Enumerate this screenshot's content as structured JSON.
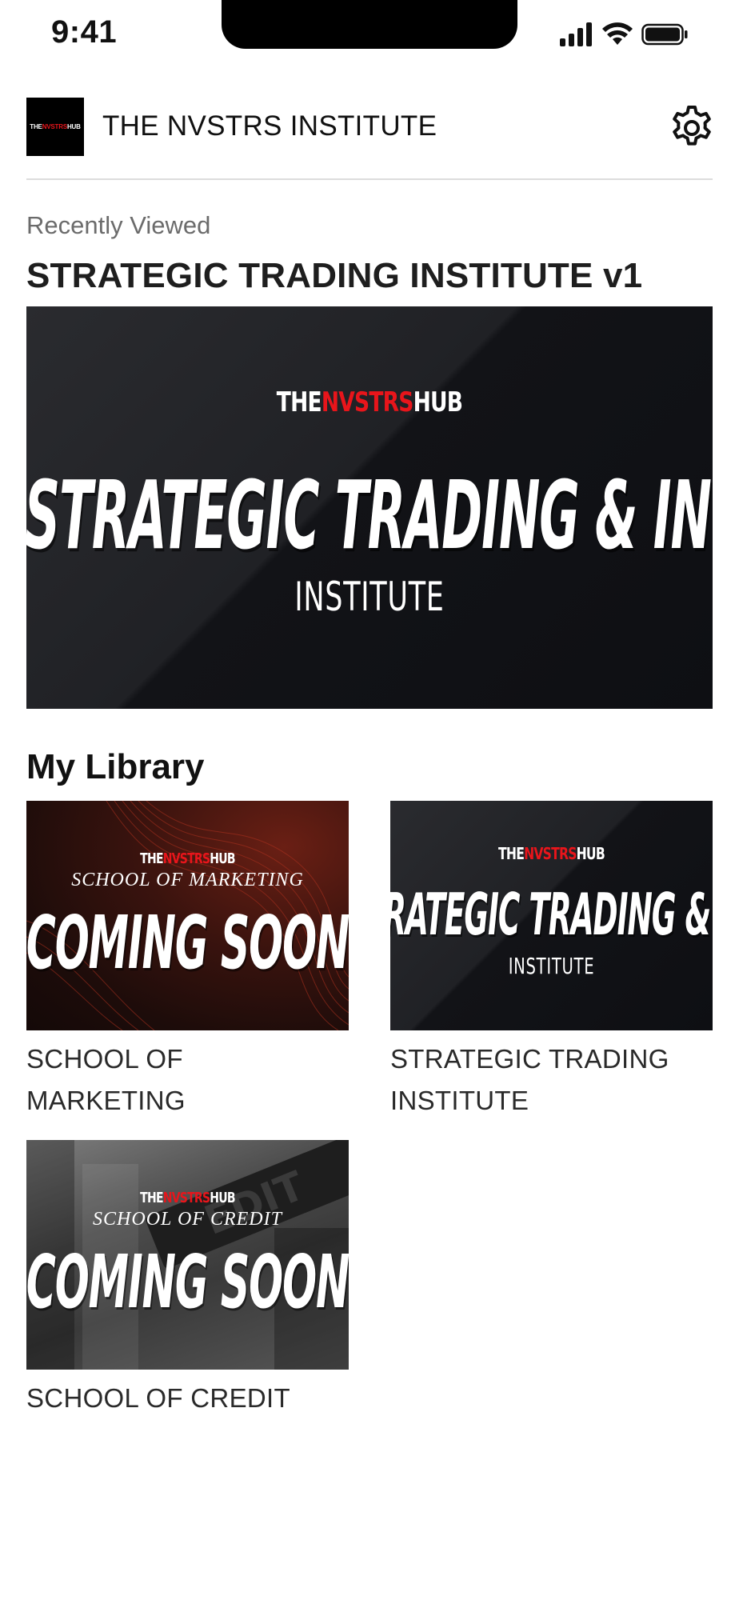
{
  "status_bar": {
    "time": "9:41"
  },
  "header": {
    "logo_parts": [
      "THE",
      "NVSTRS",
      "HUB"
    ],
    "title": "THE NVSTRS INSTITUTE"
  },
  "recently_viewed": {
    "label": "Recently Viewed",
    "title": "STRATEGIC TRADING INSTITUTE v1",
    "banner": {
      "logo_parts": [
        "THE",
        "NVSTRS",
        "HUB"
      ],
      "headline": "STRATEGIC TRADING & INVESTING",
      "subline": "INSTITUTE"
    }
  },
  "library": {
    "title": "My Library",
    "items": [
      {
        "label_line1": "SCHOOL OF",
        "label_line2": "MARKETING",
        "logo_parts": [
          "THE",
          "NVSTRS",
          "HUB"
        ],
        "school": "SCHOOL OF MARKETING",
        "status": "COMING SOON"
      },
      {
        "label_line1": "STRATEGIC TRADING",
        "label_line2": "INSTITUTE",
        "logo_parts": [
          "THE",
          "NVSTRS",
          "HUB"
        ],
        "headline": "STRATEGIC TRADING & INVESTING",
        "subline": "INSTITUTE"
      },
      {
        "label_line1": "SCHOOL OF CREDIT",
        "logo_parts": [
          "THE",
          "NVSTRS",
          "HUB"
        ],
        "school": "SCHOOL OF CREDIT",
        "status": "COMING SOON",
        "sign_text": "EDIT"
      }
    ]
  },
  "colors": {
    "accent_red": "#e8151b",
    "banner_dark": "#121317"
  }
}
